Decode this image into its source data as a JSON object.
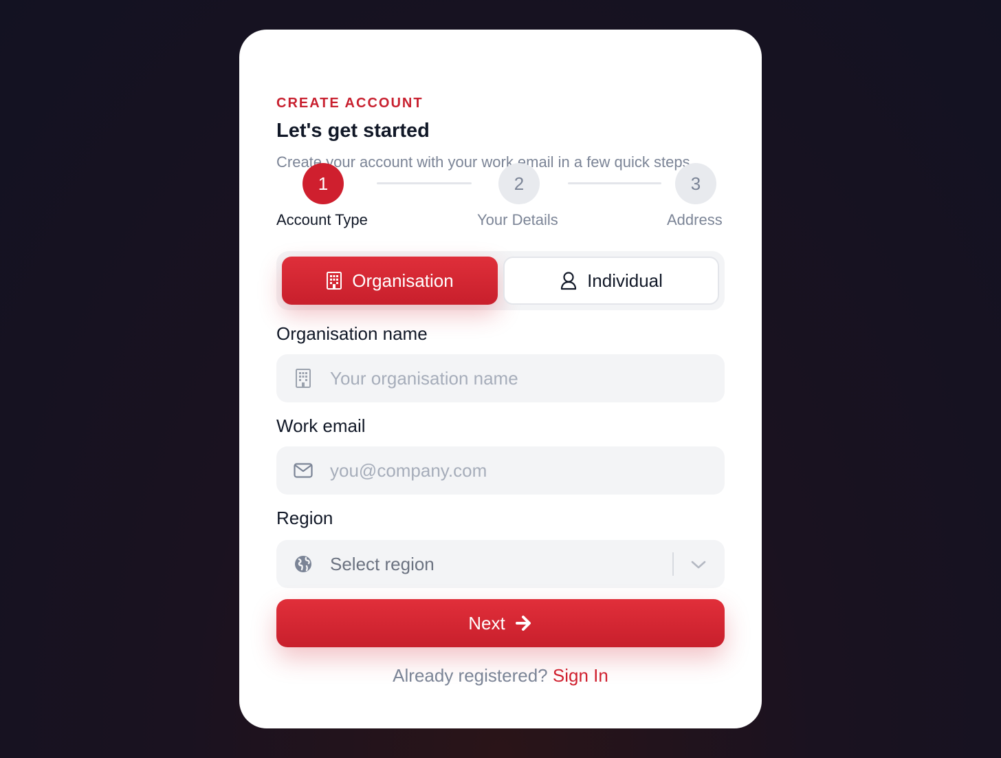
{
  "header": {
    "eyebrow": "CREATE ACCOUNT",
    "title": "Let's get started",
    "subtitle": "Create your account with your work email in a few quick steps."
  },
  "stepper": {
    "steps": [
      {
        "number": "1",
        "label": "Account Type",
        "state": "active"
      },
      {
        "number": "2",
        "label": "Your Details",
        "state": "inactive"
      },
      {
        "number": "3",
        "label": "Address",
        "state": "inactive"
      }
    ]
  },
  "account_type": {
    "options": [
      {
        "label": "Organisation",
        "icon": "building-icon",
        "selected": true
      },
      {
        "label": "Individual",
        "icon": "user-icon",
        "selected": false
      }
    ]
  },
  "form": {
    "org_name": {
      "label": "Organisation name",
      "placeholder": "Your organisation name",
      "icon": "building-icon"
    },
    "email": {
      "label": "Work email",
      "placeholder": "you@company.com",
      "icon": "mail-icon"
    },
    "region": {
      "label": "Region",
      "value": "Select region",
      "icon": "globe-icon"
    }
  },
  "actions": {
    "next_label": "Next"
  },
  "footer": {
    "prompt": "Already registered?",
    "link": "Sign In"
  },
  "colors": {
    "accent": "#cf1f2e",
    "background": "#131222",
    "card": "#ffffff",
    "muted_text": "#7b8496",
    "input_bg": "#f3f4f6"
  }
}
